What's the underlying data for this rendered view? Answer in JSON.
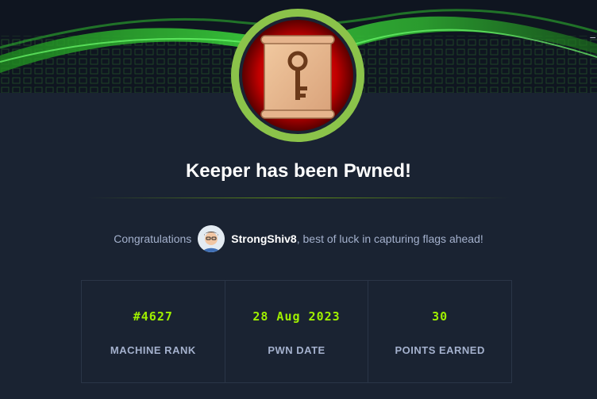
{
  "header": {
    "edge_glyph": "_"
  },
  "title": "Keeper has been Pwned!",
  "congrats": {
    "lead": "Congratulations",
    "username": "StrongShiv8",
    "tail": ", best of luck in capturing flags ahead!"
  },
  "stats": [
    {
      "value": "#4627",
      "label": "MACHINE RANK"
    },
    {
      "value": "28 Aug 2023",
      "label": "PWN DATE"
    },
    {
      "value": "30",
      "label": "POINTS EARNED"
    }
  ],
  "colors": {
    "accent": "#9fef00",
    "background": "#1a2332",
    "muted_text": "#a4b1cd",
    "badge_ring": "#8bc34a",
    "badge_core": "#b10000"
  },
  "icons": {
    "badge": "key-scroll-icon",
    "avatar": "user-avatar"
  }
}
